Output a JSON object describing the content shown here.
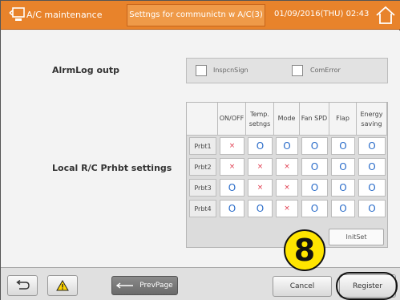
{
  "header": {
    "title": "A/C maintenance",
    "tab": "Settngs for communictn w A/C(3)",
    "datetime": "01/09/2016(THU) 02:43",
    "icons": {
      "left": "ac-unit-icon",
      "right": "home-icon"
    }
  },
  "alarm_log": {
    "label": "AlrmLog outp",
    "options": [
      {
        "label": "InspcnSign",
        "checked": false
      },
      {
        "label": "ComError",
        "checked": false
      }
    ]
  },
  "prohibit": {
    "label": "Local R/C Prhbt settings",
    "columns": [
      "ON/OFF",
      "Temp. setngs",
      "Mode",
      "Fan SPD",
      "Flap",
      "Energy saving"
    ],
    "rows": [
      {
        "name": "Prbt1",
        "values": [
          "×",
          "O",
          "O",
          "O",
          "O",
          "O"
        ]
      },
      {
        "name": "Prbt2",
        "values": [
          "×",
          "×",
          "×",
          "O",
          "O",
          "O"
        ]
      },
      {
        "name": "Prbt3",
        "values": [
          "O",
          "×",
          "×",
          "O",
          "O",
          "O"
        ]
      },
      {
        "name": "Prbt4",
        "values": [
          "O",
          "O",
          "×",
          "O",
          "O",
          "O"
        ]
      }
    ],
    "init_label": "InitSet"
  },
  "footer": {
    "prev_label": "PrevPage",
    "cancel_label": "Cancel",
    "register_label": "Register",
    "icons": {
      "back": "return-arrow-icon",
      "warning": "warning-icon",
      "prev": "left-arrow-icon"
    }
  },
  "callout": {
    "step": "8"
  },
  "colors": {
    "header": "#e8832b",
    "circle_mark": "#2a6cc9",
    "cross_mark": "#e0394c",
    "callout": "#ffe500"
  }
}
